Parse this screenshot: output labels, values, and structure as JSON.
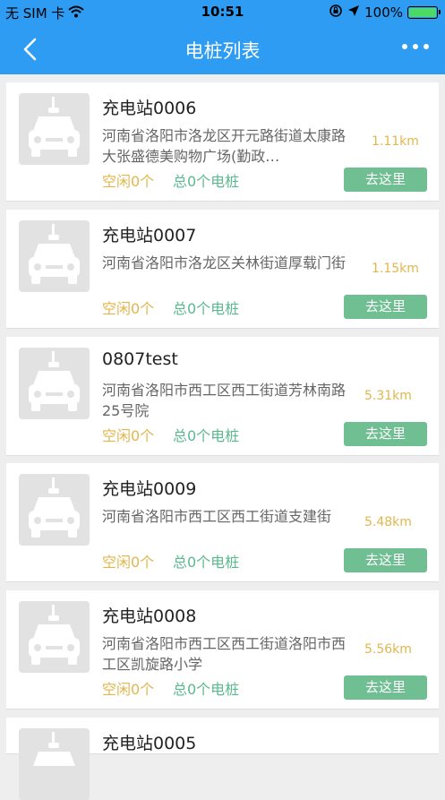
{
  "status_bar": {
    "carrier": "无 SIM 卡",
    "time": "10:51",
    "battery": "100%"
  },
  "nav": {
    "title": "电桩列表"
  },
  "stations": [
    {
      "name": "充电站0006",
      "address": "河南省洛阳市洛龙区开元路街道太康路大张盛德美购物广场(勤政…",
      "distance": "1.11km",
      "free": "空闲0个",
      "total": "总0个电桩",
      "go": "去这里"
    },
    {
      "name": "充电站0007",
      "address": "河南省洛阳市洛龙区关林街道厚载门街",
      "distance": "1.15km",
      "free": "空闲0个",
      "total": "总0个电桩",
      "go": "去这里"
    },
    {
      "name": "0807test",
      "address": "河南省洛阳市西工区西工街道芳林南路25号院",
      "distance": "5.31km",
      "free": "空闲0个",
      "total": "总0个电桩",
      "go": "去这里"
    },
    {
      "name": "充电站0009",
      "address": "河南省洛阳市西工区西工街道支建街",
      "distance": "5.48km",
      "free": "空闲0个",
      "total": "总0个电桩",
      "go": "去这里"
    },
    {
      "name": "充电站0008",
      "address": "河南省洛阳市西工区西工街道洛阳市西工区凯旋路小学",
      "distance": "5.56km",
      "free": "空闲0个",
      "total": "总0个电桩",
      "go": "去这里"
    },
    {
      "name": "充电站0005",
      "address": "",
      "distance": "",
      "free": "",
      "total": "",
      "go": ""
    }
  ],
  "colors": {
    "nav_bg": "#2d9cf2",
    "distance": "#e2b64c",
    "free": "#e2b64c",
    "total": "#5bb88f",
    "go_button": "#6fbf93"
  },
  "icons": [
    "wifi-icon",
    "location-lock-icon",
    "location-arrow-icon",
    "battery-icon",
    "back-chevron-icon",
    "more-icon",
    "car-placeholder-icon"
  ]
}
